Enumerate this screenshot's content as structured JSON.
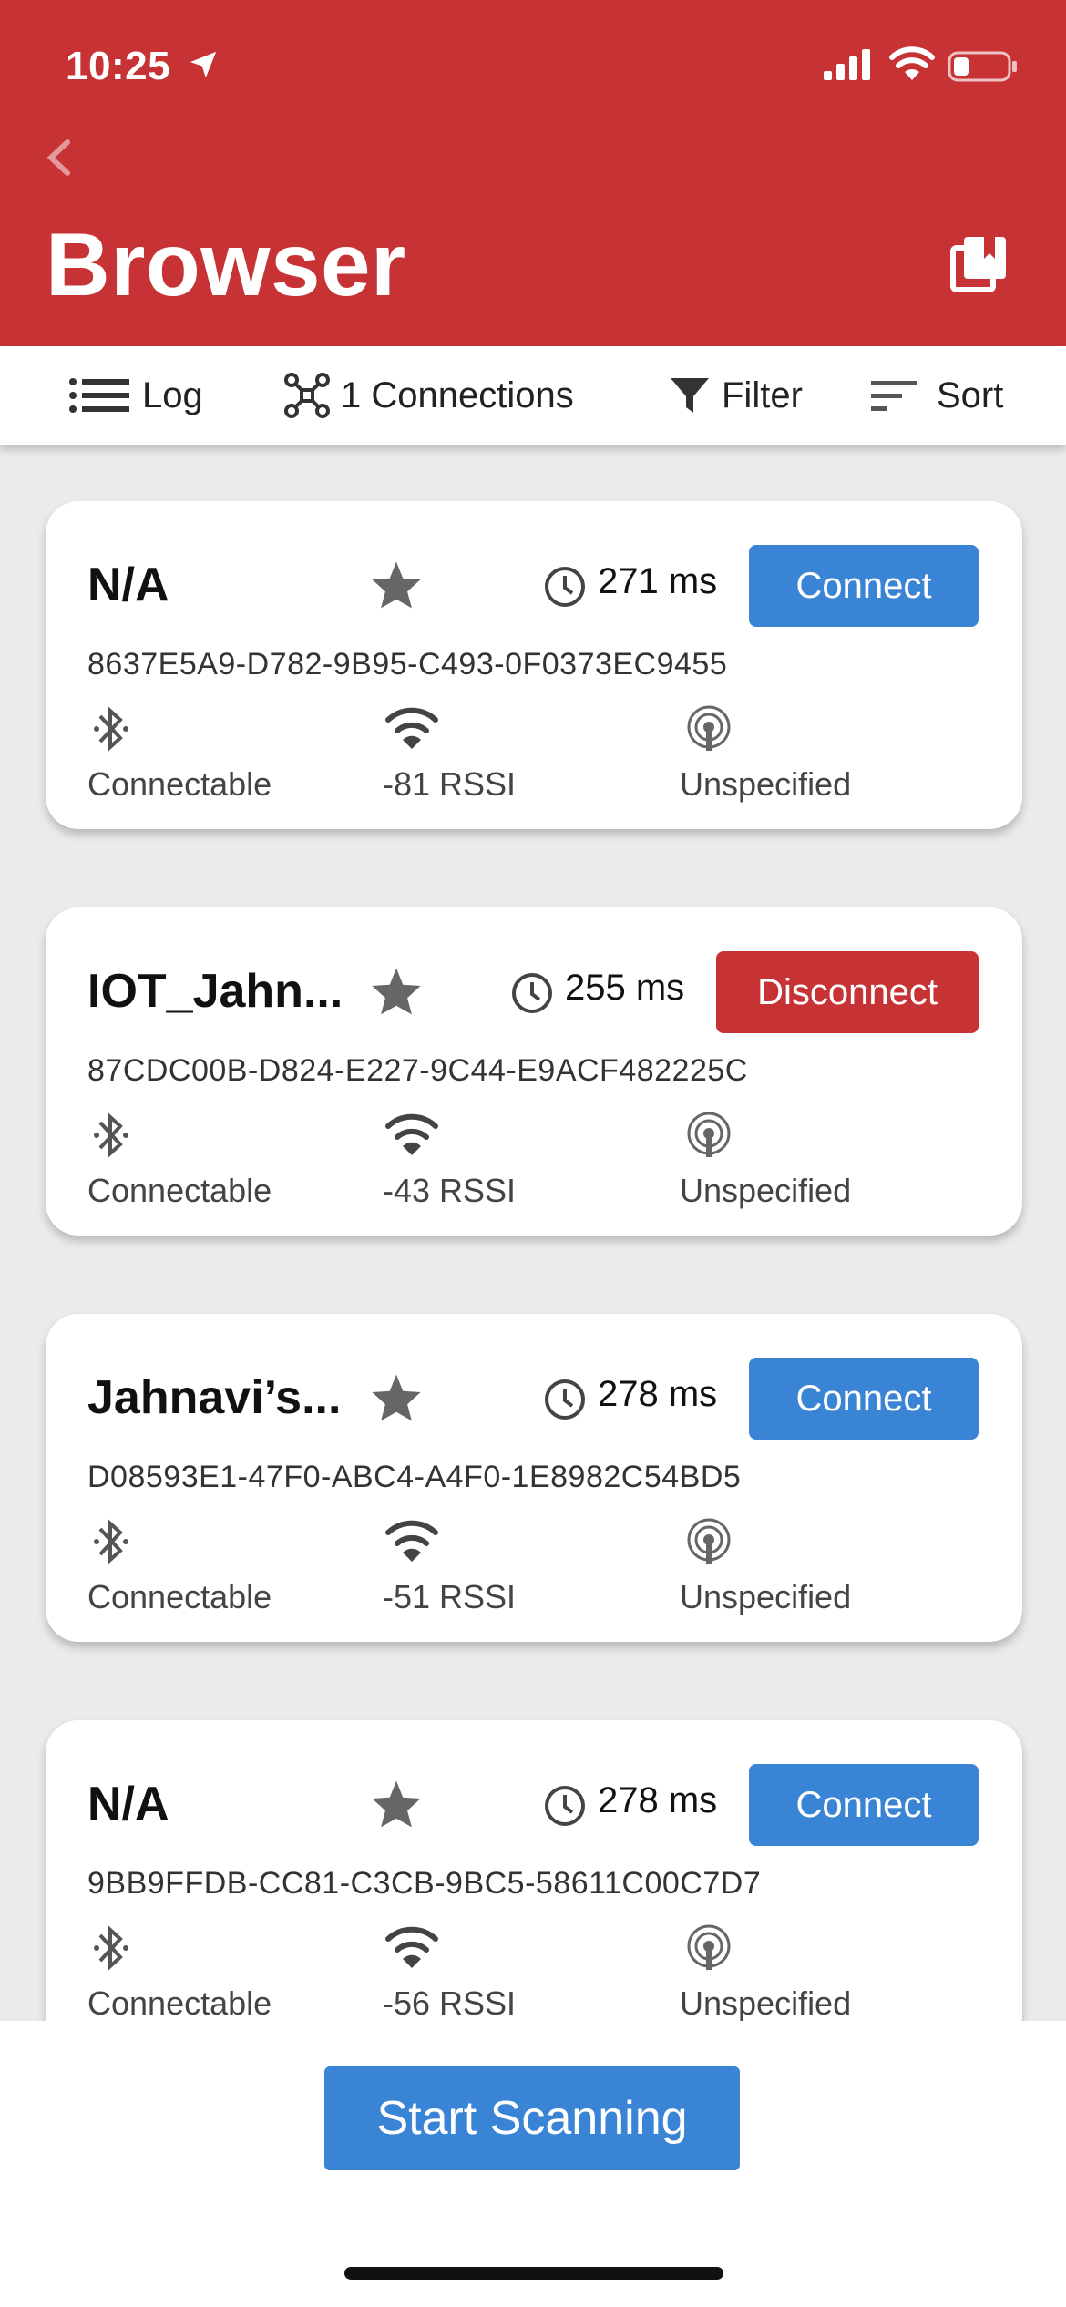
{
  "status_bar": {
    "time": "10:25"
  },
  "header": {
    "title": "Browser"
  },
  "toolbar": {
    "log_label": "Log",
    "connections_label": "1 Connections",
    "filter_label": "Filter",
    "sort_label": "Sort"
  },
  "devices": [
    {
      "name": "N/A",
      "time": "271 ms",
      "action": "Connect",
      "uuid": "8637E5A9-D782-9B95-C493-0F0373EC9455",
      "connectable": "Connectable",
      "rssi": "-81 RSSI",
      "type": "Unspecified"
    },
    {
      "name": "IOT_Jahn...",
      "time": "255 ms",
      "action": "Disconnect",
      "uuid": "87CDC00B-D824-E227-9C44-E9ACF482225C",
      "connectable": "Connectable",
      "rssi": "-43 RSSI",
      "type": "Unspecified"
    },
    {
      "name": "Jahnavi’s...",
      "time": "278 ms",
      "action": "Connect",
      "uuid": "D08593E1-47F0-ABC4-A4F0-1E8982C54BD5",
      "connectable": "Connectable",
      "rssi": "-51 RSSI",
      "type": "Unspecified"
    },
    {
      "name": "N/A",
      "time": "278 ms",
      "action": "Connect",
      "uuid": "9BB9FFDB-CC81-C3CB-9BC5-58611C00C7D7",
      "connectable": "Connectable",
      "rssi": "-56 RSSI",
      "type": "Unspecified"
    }
  ],
  "footer": {
    "scan_label": "Start Scanning"
  },
  "colors": {
    "header": "#c73234",
    "primary": "#3a84d6",
    "danger": "#c73234"
  },
  "icons": [
    "location-arrow-icon",
    "cellular-signal-icon",
    "wifi-icon",
    "battery-icon",
    "back-chevron-icon",
    "bookmark-stack-icon",
    "list-icon",
    "network-icon",
    "filter-icon",
    "sort-icon",
    "star-icon",
    "clock-icon",
    "bluetooth-icon",
    "signal-icon",
    "broadcast-icon"
  ]
}
